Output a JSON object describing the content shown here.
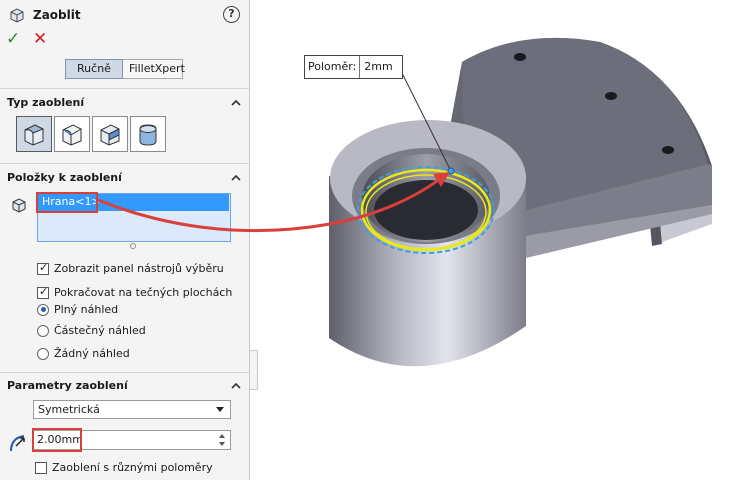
{
  "panel": {
    "title": "Zaoblit",
    "help_icon": "?",
    "ok_icon": "✓",
    "cancel_icon": "✕",
    "tabs": [
      {
        "label": "Ručně",
        "active": true
      },
      {
        "label": "FilletXpert",
        "active": false
      }
    ]
  },
  "fillet_type": {
    "header": "Typ zaoblení",
    "options": [
      "constant-size-fillet-icon",
      "variable-size-fillet-icon",
      "face-fillet-icon",
      "full-round-fillet-icon"
    ],
    "selected_index": 0
  },
  "items": {
    "header": "Položky k zaoblení",
    "selected": [
      "Hrana<1>"
    ],
    "options": [
      {
        "label": "Zobrazit panel nástrojů výběru",
        "type": "checkbox",
        "checked": true
      },
      {
        "label": "Pokračovat na tečných plochách",
        "type": "checkbox",
        "checked": true
      },
      {
        "label": "Plný náhled",
        "type": "radio",
        "checked": true
      },
      {
        "label": "Částečný náhled",
        "type": "radio",
        "checked": false
      },
      {
        "label": "Žádný náhled",
        "type": "radio",
        "checked": false
      }
    ]
  },
  "parameters": {
    "header": "Parametry zaoblení",
    "profile": "Symetrická",
    "radius": "2.00mm",
    "multi_radius": {
      "label": "Zaoblení s různými poloměry",
      "checked": false
    }
  },
  "callout": {
    "label": "Poloměr:",
    "value": "2mm"
  },
  "colors": {
    "highlight": "#3399ff",
    "annotation": "#d9403a",
    "preview": "#e8e81a"
  }
}
